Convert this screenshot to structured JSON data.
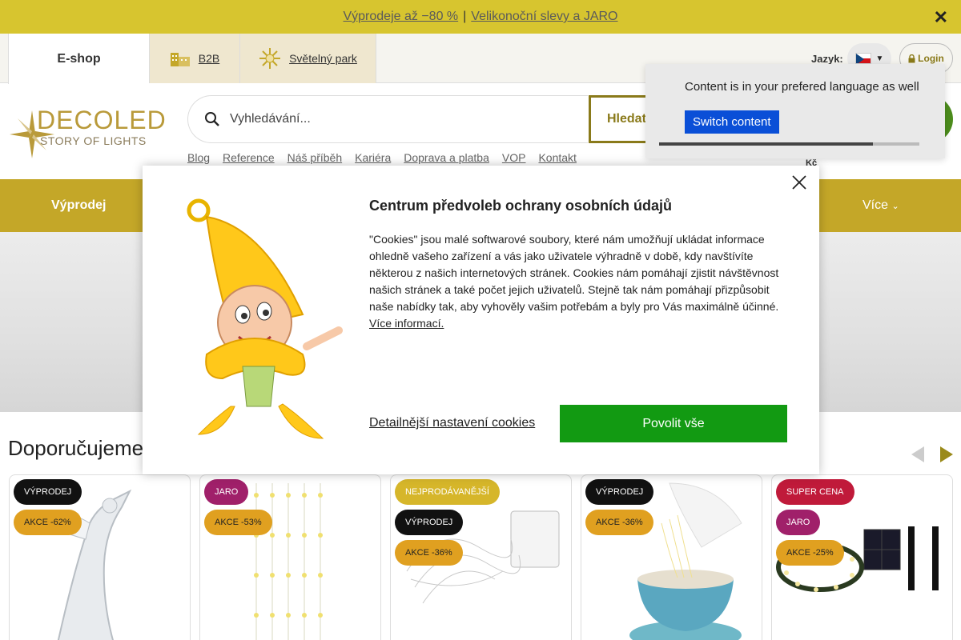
{
  "promo": {
    "link1": "Výprodeje až −80 %",
    "separator": "|",
    "link2": "Velikonoční slevy a JARO",
    "close_glyph": "✕"
  },
  "header": {
    "tab_eshop": "E-shop",
    "tab_b2b": "B2B",
    "tab_park": "Světelný park",
    "language_label": "Jazyk:",
    "login_label": "Login"
  },
  "logo": {
    "line1": "DECOLED",
    "line2": "STORY OF LIGHTS"
  },
  "search": {
    "placeholder": "Vyhledávání...",
    "button_label": "Hledat"
  },
  "cart_fragment": "Kč",
  "nav_links": [
    "Blog",
    "Reference",
    "Náš příběh",
    "Kariéra",
    "Doprava a platba",
    "VOP",
    "Kontakt"
  ],
  "menu": {
    "first": "Výprodej",
    "more": "Více"
  },
  "recommended": {
    "title": "Doporučujeme"
  },
  "products": [
    {
      "badges": [
        "VÝPRODEJ",
        "AKCE -62%"
      ]
    },
    {
      "badges": [
        "JARO",
        "AKCE -53%"
      ]
    },
    {
      "badges": [
        "NEJPRODÁVANĚJŠÍ",
        "VÝPRODEJ",
        "AKCE -36%"
      ]
    },
    {
      "badges": [
        "VÝPRODEJ",
        "AKCE -36%"
      ]
    },
    {
      "badges": [
        "SUPER CENA",
        "JARO",
        "AKCE -25%"
      ]
    }
  ],
  "cookie": {
    "title": "Centrum předvoleb ochrany osobních údajů",
    "text": "\"Cookies\" jsou malé softwarové soubory, které nám umožňují ukládat informace ohledně vašeho zařízení a vás jako uživatele výhradně v době, kdy navštívíte některou z našich internetových stránek. Cookies nám pomáhají zjistit návštěvnost našich stránek a také počet jejich uživatelů. Stejně tak nám pomáhají přizpůsobit naše nabídky tak, aby vyhověly vašim potřebám a byly pro Vás maximálně účinné.",
    "more_link": "Více informací.",
    "detail_link": "Detailnější nastavení cookies",
    "allow_button": "Povolit vše"
  },
  "language_popup": {
    "message": "Content is in your prefered language as well",
    "switch_button": "Switch content",
    "progress": 0.82
  },
  "colors": {
    "promo_bg": "#d7c52f",
    "menu_bg": "#c4a728",
    "accent_green": "#129a12",
    "switch_blue": "#0a4fd7"
  }
}
